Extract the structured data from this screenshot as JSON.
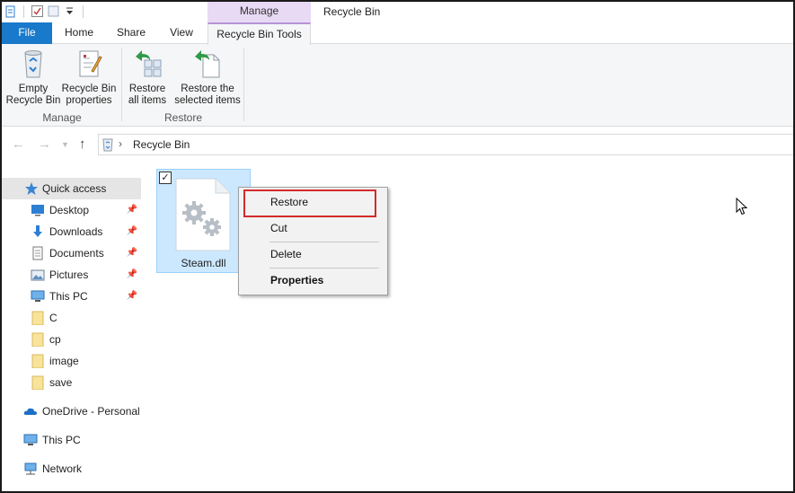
{
  "titlebar": {
    "context_tab_label": "Manage",
    "window_title": "Recycle Bin"
  },
  "tabs": {
    "file": "File",
    "home": "Home",
    "share": "Share",
    "view": "View",
    "recycle_bin_tools": "Recycle Bin Tools"
  },
  "ribbon": {
    "groups": [
      {
        "label": "Manage",
        "buttons": [
          {
            "label": "Empty\nRecycle Bin",
            "icon": "recycle-bin-icon"
          },
          {
            "label": "Recycle Bin\nproperties",
            "icon": "properties-icon"
          }
        ]
      },
      {
        "label": "Restore",
        "buttons": [
          {
            "label": "Restore\nall items",
            "icon": "restore-all-icon"
          },
          {
            "label": "Restore the\nselected items",
            "icon": "restore-selected-icon"
          }
        ]
      }
    ]
  },
  "address": {
    "crumb": "Recycle Bin"
  },
  "sidebar": {
    "quick_access": "Quick access",
    "items": [
      {
        "label": "Desktop",
        "pinned": true,
        "icon": "desktop-icon"
      },
      {
        "label": "Downloads",
        "pinned": true,
        "icon": "download-icon"
      },
      {
        "label": "Documents",
        "pinned": true,
        "icon": "documents-icon"
      },
      {
        "label": "Pictures",
        "pinned": true,
        "icon": "pictures-icon"
      },
      {
        "label": "This PC",
        "pinned": true,
        "icon": "computer-icon"
      },
      {
        "label": "C",
        "pinned": false,
        "icon": "folder-icon"
      },
      {
        "label": "cp",
        "pinned": false,
        "icon": "folder-icon"
      },
      {
        "label": "image",
        "pinned": false,
        "icon": "folder-icon"
      },
      {
        "label": "save",
        "pinned": false,
        "icon": "folder-icon"
      }
    ],
    "onedrive": "OneDrive - Personal",
    "this_pc": "This PC",
    "network": "Network"
  },
  "content": {
    "file_name": "Steam.dll",
    "file_checked": true
  },
  "context_menu": {
    "items": [
      "Restore",
      "Cut",
      "Delete",
      "Properties"
    ]
  },
  "colors": {
    "file_tab": "#1979ca",
    "context_tab": "#e8d9f5",
    "selection": "#cce8ff",
    "highlight_box": "#d32a2a"
  }
}
